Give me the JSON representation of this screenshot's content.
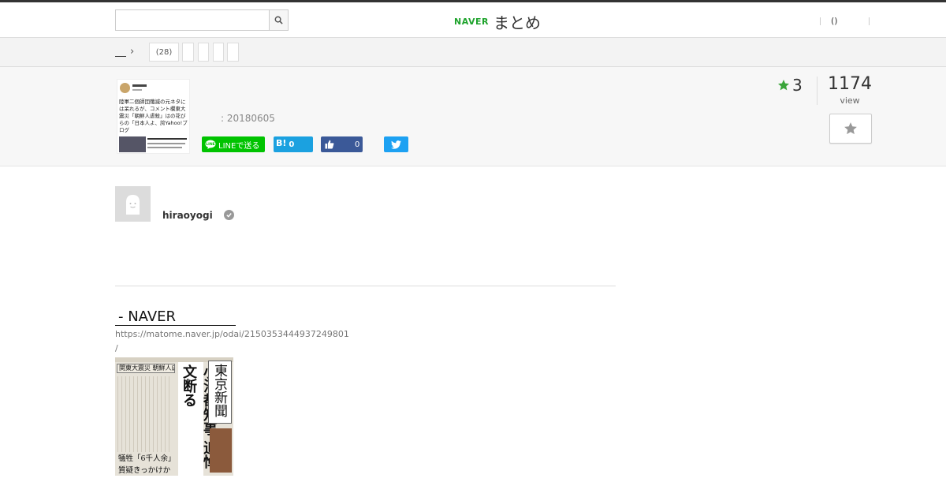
{
  "header": {
    "search_placeholder": "",
    "logo_brand": "NAVER",
    "logo_product": "まとめ",
    "right_links": "()"
  },
  "breadcrumb": {
    "count_chip": "(28)"
  },
  "summary": {
    "thumbnail_text": "陸軍二個師団殲滅の元ネタには呆れるが、コメント欄東大震災「朝鮮人虐殺」はの花びらの「日本人よ、誇Yahoo!ブログ",
    "date": ": 20180605",
    "share_line": "LINEで送る",
    "share_hatena_label": "B!",
    "share_hatena_count": "0",
    "share_fb_count": "0",
    "favorite_count": "3",
    "view_count": "1174",
    "view_label": "view"
  },
  "author": {
    "name": "hiraoyogi"
  },
  "content": {
    "link_title": " - NAVER",
    "link_url": "https://matome.naver.jp/odai/2150353444937249801",
    "slash": "/",
    "newspaper_name": "東京新聞",
    "headline": "小池都知事 追悼文断る",
    "subhead": "関東大震災 朝鮮人虐殺",
    "caption_1": "犠牲「6千人余」",
    "caption_2": "質疑きっかけか"
  },
  "colors": {
    "naver_green": "#1ea32c",
    "line_green": "#00c300",
    "hatena_blue": "#1ba1e0",
    "fb_blue": "#3b5998",
    "twitter_blue": "#1da1f2",
    "star_green": "#3aa53a"
  }
}
